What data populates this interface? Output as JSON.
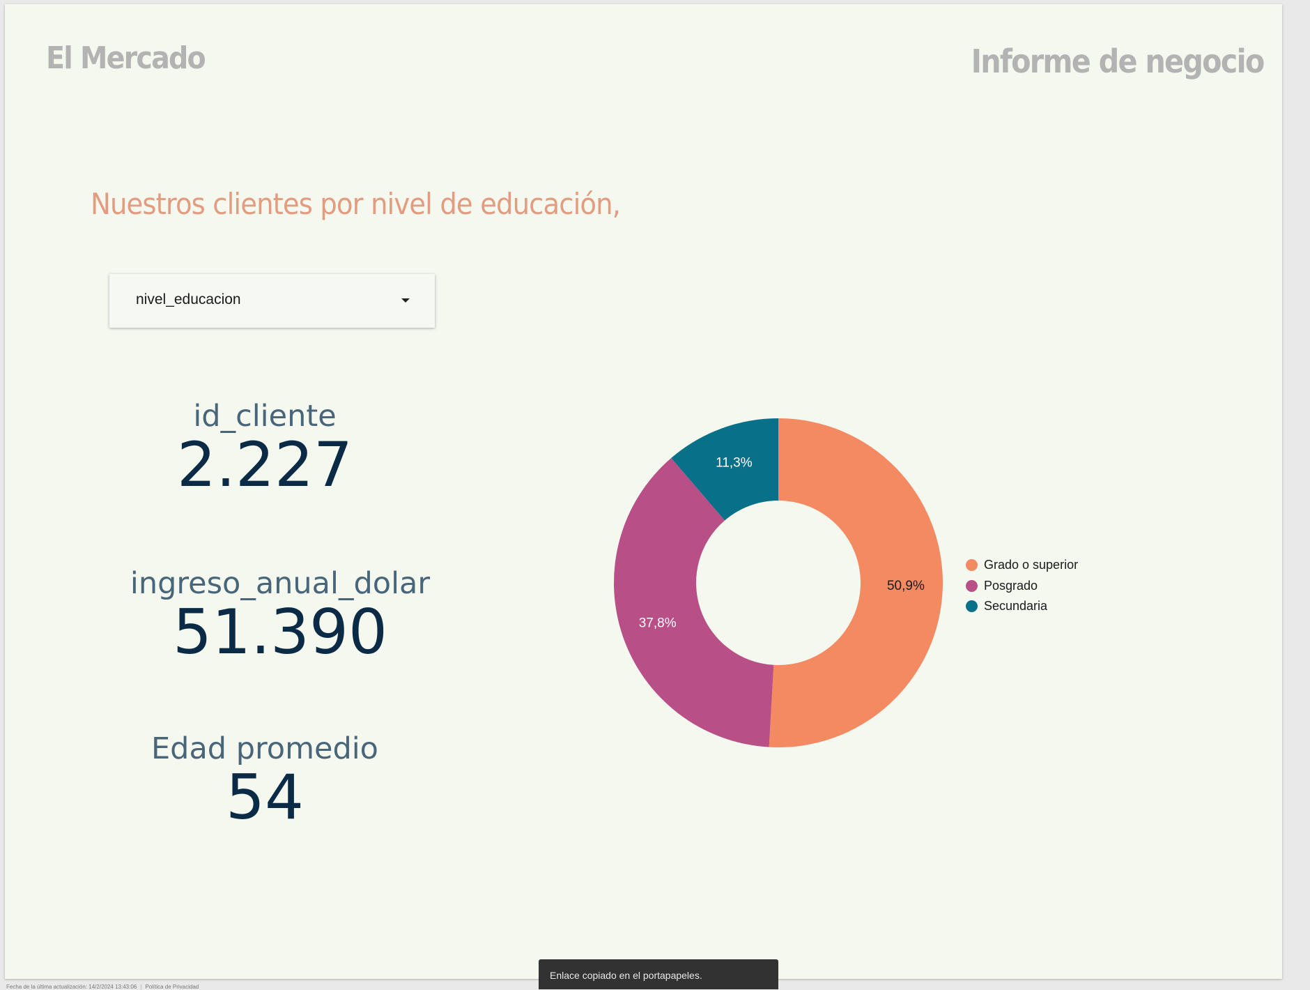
{
  "header": {
    "brand": "El Mercado",
    "report_title": "Informe de negocio"
  },
  "section": {
    "heading": "Nuestros clientes por nivel de educación,"
  },
  "filter": {
    "label": "nivel_educacion",
    "icon": "caret-down-icon"
  },
  "kpis": [
    {
      "label": "id_cliente",
      "value": "2.227"
    },
    {
      "label": "ingreso_anual_dolar",
      "value": "51.390"
    },
    {
      "label": "Edad promedio",
      "value": "54"
    }
  ],
  "chart_data": {
    "type": "pie",
    "donut": true,
    "categories": [
      "Grado o superior",
      "Posgrado",
      "Secundaria"
    ],
    "values": [
      50.9,
      37.8,
      11.3
    ],
    "value_labels": [
      "50,9%",
      "37,8%",
      "11,3%"
    ],
    "colors": [
      "#f38a62",
      "#b85087",
      "#087089"
    ],
    "label_colors": [
      "#1a1a1a",
      "#ffffff",
      "#ffffff"
    ],
    "legend_position": "right"
  },
  "footer": {
    "updated": "Fecha de la última actualización: 14/2/2024 13:43:06",
    "privacy": "Política de Privacidad"
  },
  "toast": {
    "message": "Enlace copiado en el portapapeles."
  }
}
